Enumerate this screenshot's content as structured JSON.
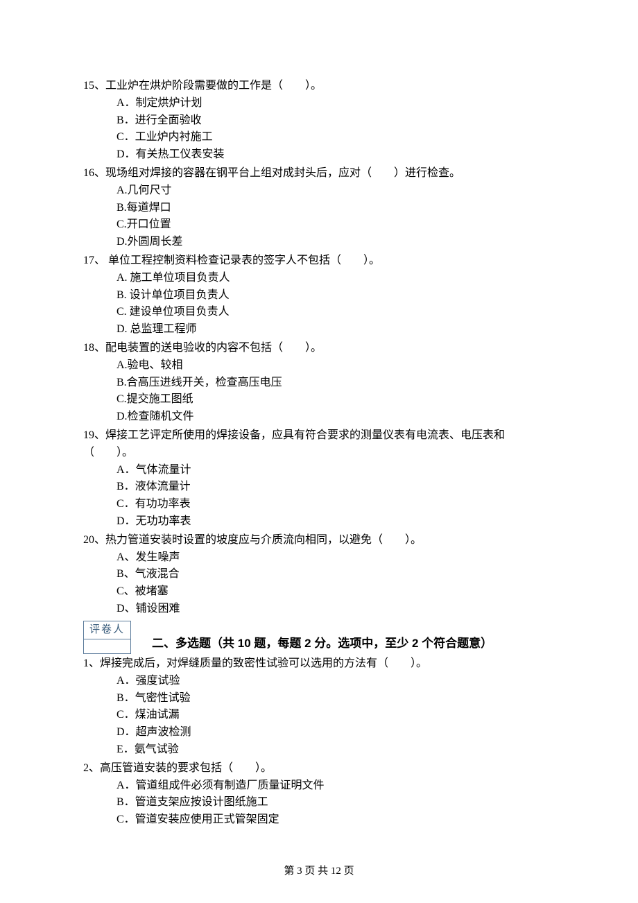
{
  "questions": [
    {
      "num": "15、",
      "stem": "工业炉在烘炉阶段需要做的工作是（　　）。",
      "opts": [
        "A．制定烘炉计划",
        "B．进行全面验收",
        "C．工业炉内衬施工",
        "D．有关热工仪表安装"
      ]
    },
    {
      "num": "16、",
      "stem": "现场组对焊接的容器在钢平台上组对成封头后，应对（　　）进行检查。",
      "opts": [
        "A.几何尺寸",
        "B.每道焊口",
        "C.开口位置",
        "D.外圆周长差"
      ]
    },
    {
      "num": "17、",
      "stem": " 单位工程控制资料检查记录表的签字人不包括（　　）。",
      "opts": [
        "A. 施工单位项目负责人",
        "B. 设计单位项目负责人",
        "C. 建设单位项目负责人",
        "D. 总监理工程师"
      ]
    },
    {
      "num": "18、",
      "stem": "配电装置的送电验收的内容不包括（　　）。",
      "opts": [
        "A.验电、较相",
        "B.合高压进线开关，检查高压电压",
        "C.提交施工图纸",
        "D.检查随机文件"
      ]
    },
    {
      "num": "19、",
      "stem": "焊接工艺评定所使用的焊接设备，应具有符合要求的测量仪表有电流表、电压表和",
      "cont": "（　　）。",
      "opts": [
        "A．气体流量计",
        "B．液体流量计",
        "C．有功功率表",
        "D．无功功率表"
      ]
    },
    {
      "num": "20、",
      "stem": "热力管道安装时设置的坡度应与介质流向相同，以避免（　　）。",
      "opts": [
        "A、发生噪声",
        "B、气液混合",
        "C、被堵塞",
        "D、铺设困难"
      ]
    }
  ],
  "reviewer_label": "评卷人",
  "section2_heading": "二、多选题（共 10 题，每题 2 分。选项中，至少 2 个符合题意）",
  "section2_questions": [
    {
      "num": "1、",
      "stem": "焊接完成后，对焊缝质量的致密性试验可以选用的方法有（　　）。",
      "opts": [
        "A．强度试验",
        "B．气密性试验",
        "C．煤油试漏",
        "D．超声波检测",
        "E．氨气试验"
      ]
    },
    {
      "num": "2、",
      "stem": "高压管道安装的要求包括（　　）。",
      "opts": [
        "A．管道组成件必须有制造厂质量证明文件",
        "B．管道支架应按设计图纸施工",
        "C．管道安装应使用正式管架固定"
      ]
    }
  ],
  "footer": "第 3 页 共 12 页"
}
